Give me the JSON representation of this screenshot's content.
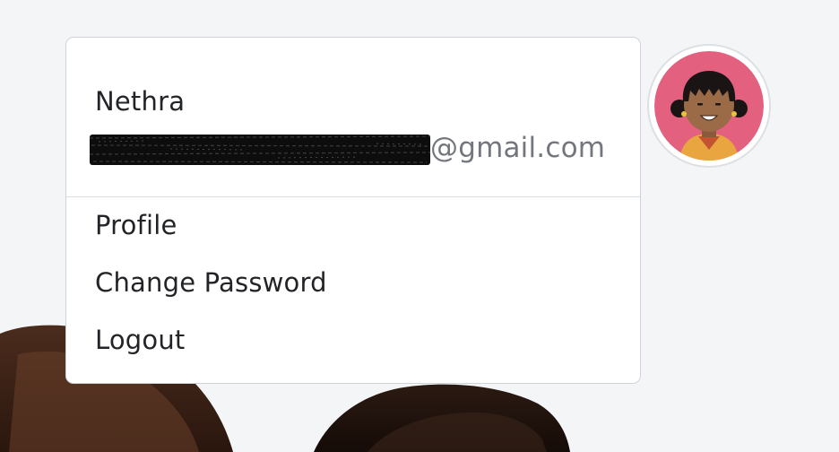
{
  "user": {
    "name": "Nethra",
    "email_domain": "@gmail.com"
  },
  "menu": {
    "items": [
      "Profile",
      "Change Password",
      "Logout"
    ]
  },
  "colors": {
    "avatar_background": "#e4607f",
    "text_primary": "#222427",
    "text_secondary": "#73777d",
    "divider": "#d9dce0"
  }
}
